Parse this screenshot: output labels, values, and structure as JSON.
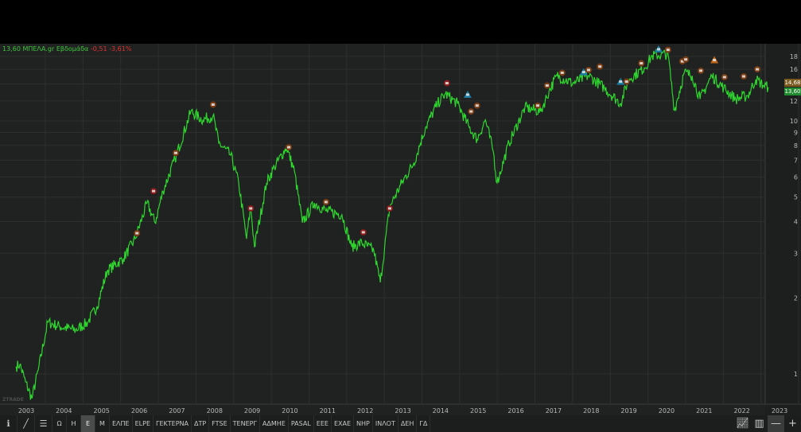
{
  "header": {
    "price": "13,60",
    "symbol": "ΜΠΕΛΑ.gr",
    "period": "Εβδομάδα",
    "change": "-0,51",
    "change_pct": "-3,61%"
  },
  "price_tags": {
    "upper": "14,68",
    "last": "13,60"
  },
  "watermark": "ZTRADE",
  "colors": {
    "line": "#2ed62e",
    "bg": "#202221",
    "grid": "#2c2f2d",
    "S": "#8a1c1c",
    "D": "#7a3c14",
    "E": "#1a7aa0",
    "T": "#c06818"
  },
  "toolbar": {
    "items": [
      "Ω",
      "Η",
      "Ε",
      "Μ",
      "ΕΛΠΕ",
      "ELPE",
      "ΓΕΚΤΕΡΝΑ",
      "ΔΤΡ",
      "FTSE",
      "ΤΕΝΕΡΓ",
      "ΑΔΜΗΕ",
      "PASAL",
      "ΕΕΕ",
      "ΕΧΑΕ",
      "ΝΗΡ",
      "ΙΝΛΟΤ",
      "ΔΕΗ",
      "ΓΔ"
    ],
    "selected": "Ε",
    "icons": [
      "info-icon",
      "draw-line-icon",
      "indicators-icon"
    ]
  },
  "right_tools": [
    "line-chart-icon",
    "bar-chart-icon",
    "zoom-out-icon",
    "zoom-in-icon"
  ],
  "chart_data": {
    "type": "line",
    "title": "ΜΠΕΛΑ.gr Εβδομάδα",
    "yscale": "log",
    "ylim": [
      0.75,
      21
    ],
    "xlim": [
      2002.4,
      2023.3
    ],
    "yticks": [
      1,
      2,
      3,
      4,
      5,
      6,
      7,
      8,
      9,
      10,
      12,
      14,
      16,
      18
    ],
    "xticks": [
      "2003",
      "2004",
      "2005",
      "2006",
      "2007",
      "2008",
      "2009",
      "2010",
      "2011",
      "2012",
      "2013",
      "2014",
      "2015",
      "2016",
      "2017",
      "2018",
      "2019",
      "2020",
      "2021",
      "2022",
      "2023"
    ],
    "grid": true,
    "series": [
      {
        "name": "ΜΠΕΛΑ",
        "points": [
          [
            2002.73,
            1.07
          ],
          [
            2002.83,
            1.09
          ],
          [
            2002.98,
            0.93
          ],
          [
            2003.15,
            0.8
          ],
          [
            2003.32,
            1.04
          ],
          [
            2003.57,
            1.6
          ],
          [
            2003.89,
            1.54
          ],
          [
            2004.31,
            1.49
          ],
          [
            2004.63,
            1.6
          ],
          [
            2004.88,
            1.85
          ],
          [
            2005.15,
            2.56
          ],
          [
            2005.58,
            2.86
          ],
          [
            2005.89,
            3.42
          ],
          [
            2006.21,
            4.74
          ],
          [
            2006.42,
            3.96
          ],
          [
            2006.63,
            5.28
          ],
          [
            2006.95,
            7.06
          ],
          [
            2007.37,
            10.9
          ],
          [
            2007.69,
            10.1
          ],
          [
            2007.96,
            10.5
          ],
          [
            2008.11,
            8.18
          ],
          [
            2008.43,
            7.32
          ],
          [
            2008.64,
            5.69
          ],
          [
            2008.85,
            3.42
          ],
          [
            2008.96,
            4.58
          ],
          [
            2009.06,
            3.18
          ],
          [
            2009.38,
            5.69
          ],
          [
            2009.59,
            6.58
          ],
          [
            2009.91,
            7.87
          ],
          [
            2010.12,
            6.34
          ],
          [
            2010.33,
            3.96
          ],
          [
            2010.65,
            4.74
          ],
          [
            2010.96,
            4.41
          ],
          [
            2011.38,
            4.26
          ],
          [
            2011.64,
            3.18
          ],
          [
            2011.91,
            3.3
          ],
          [
            2012.23,
            3.07
          ],
          [
            2012.4,
            2.3
          ],
          [
            2012.65,
            4.58
          ],
          [
            2012.97,
            5.69
          ],
          [
            2013.29,
            6.81
          ],
          [
            2013.6,
            9.43
          ],
          [
            2013.92,
            11.7
          ],
          [
            2014.13,
            12.8
          ],
          [
            2014.45,
            11.7
          ],
          [
            2014.76,
            9.43
          ],
          [
            2014.97,
            8.45
          ],
          [
            2015.19,
            10.1
          ],
          [
            2015.4,
            7.6
          ],
          [
            2015.5,
            5.69
          ],
          [
            2015.82,
            8.18
          ],
          [
            2016.24,
            11.3
          ],
          [
            2016.66,
            10.9
          ],
          [
            2016.88,
            13.1
          ],
          [
            2017.09,
            15.1
          ],
          [
            2017.51,
            14.1
          ],
          [
            2017.93,
            15.1
          ],
          [
            2018.35,
            13.5
          ],
          [
            2018.78,
            11.7
          ],
          [
            2018.99,
            14.6
          ],
          [
            2019.41,
            16.2
          ],
          [
            2019.62,
            18.1
          ],
          [
            2020.04,
            18.4
          ],
          [
            2020.21,
            11.0
          ],
          [
            2020.47,
            15.5
          ],
          [
            2020.68,
            15.1
          ],
          [
            2020.89,
            12.2
          ],
          [
            2021.2,
            15.1
          ],
          [
            2021.52,
            13.5
          ],
          [
            2021.84,
            12.2
          ],
          [
            2022.16,
            12.6
          ],
          [
            2022.37,
            14.6
          ],
          [
            2022.58,
            13.8
          ],
          [
            2022.7,
            13.6
          ]
        ]
      }
    ],
    "markers": [
      {
        "type": "S",
        "year": 2006.38,
        "price": 5.28
      },
      {
        "type": "S",
        "year": 2008.96,
        "price": 4.51
      },
      {
        "type": "S",
        "year": 2011.95,
        "price": 3.63
      },
      {
        "type": "S",
        "year": 2012.65,
        "price": 4.51
      },
      {
        "type": "S",
        "year": 2014.17,
        "price": 14.1
      },
      {
        "type": "D",
        "year": 2005.94,
        "price": 3.6
      },
      {
        "type": "D",
        "year": 2006.97,
        "price": 7.47
      },
      {
        "type": "D",
        "year": 2007.96,
        "price": 11.6
      },
      {
        "type": "D",
        "year": 2009.97,
        "price": 7.87
      },
      {
        "type": "D",
        "year": 2010.96,
        "price": 4.78
      },
      {
        "type": "D",
        "year": 2014.81,
        "price": 10.9
      },
      {
        "type": "D",
        "year": 2014.97,
        "price": 11.5
      },
      {
        "type": "D",
        "year": 2016.58,
        "price": 11.5
      },
      {
        "type": "D",
        "year": 2016.83,
        "price": 13.8
      },
      {
        "type": "D",
        "year": 2017.23,
        "price": 15.5
      },
      {
        "type": "D",
        "year": 2017.93,
        "price": 15.9
      },
      {
        "type": "D",
        "year": 2018.23,
        "price": 16.4
      },
      {
        "type": "D",
        "year": 2018.94,
        "price": 14.3
      },
      {
        "type": "D",
        "year": 2019.33,
        "price": 16.9
      },
      {
        "type": "D",
        "year": 2020.04,
        "price": 19.1
      },
      {
        "type": "D",
        "year": 2020.42,
        "price": 17.2
      },
      {
        "type": "D",
        "year": 2020.51,
        "price": 17.5
      },
      {
        "type": "D",
        "year": 2020.91,
        "price": 15.8
      },
      {
        "type": "D",
        "year": 2021.54,
        "price": 14.9
      },
      {
        "type": "D",
        "year": 2022.05,
        "price": 15.0
      },
      {
        "type": "D",
        "year": 2022.41,
        "price": 16.0
      },
      {
        "type": "E",
        "year": 2014.72,
        "price": 12.7
      },
      {
        "type": "E",
        "year": 2017.8,
        "price": 15.6
      },
      {
        "type": "E",
        "year": 2018.78,
        "price": 14.3
      },
      {
        "type": "E",
        "year": 2019.79,
        "price": 19.2
      },
      {
        "type": "T",
        "year": 2021.27,
        "price": 17.4
      }
    ]
  }
}
